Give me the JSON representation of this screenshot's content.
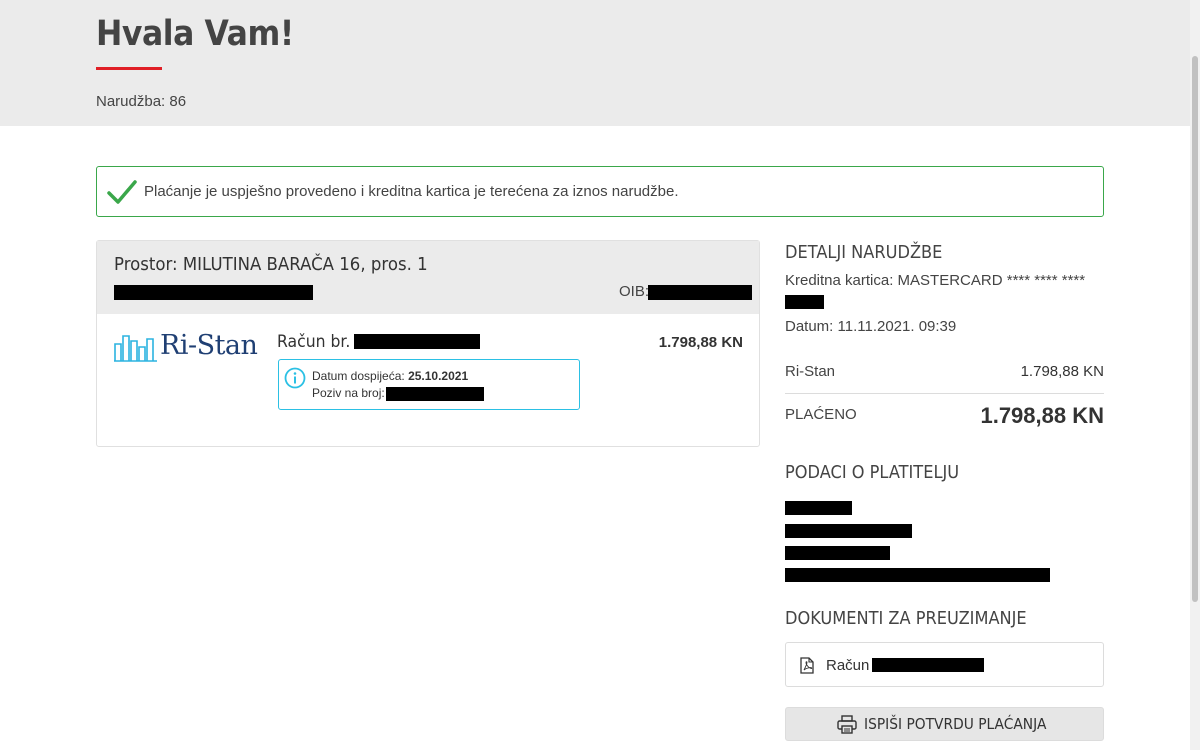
{
  "header": {
    "title": "Hvala Vam!",
    "order_line": "Narudžba: 86"
  },
  "alert": {
    "message": "Plaćanje je uspješno provedeno i kreditna kartica je terećena za iznos narudžbe.",
    "color": "#3aa74a"
  },
  "invoice_card": {
    "location": "Prostor: MILUTINA BARAČA 16, pros. 1",
    "oib_label": "OIB:",
    "logo_text": "Ri-Stan",
    "invoice_label": "Račun br.",
    "amount": "1.798,88 KN",
    "due_label": "Datum dospijeća:",
    "due_date": "25.10.2021",
    "reference_label": "Poziv na broj:"
  },
  "order_details": {
    "title": "DETALJI NARUDŽBE",
    "card_line": "Kreditna kartica: MASTERCARD **** **** ****",
    "date_line": "Datum: 11.11.2021. 09:39",
    "item_name": "Ri-Stan",
    "item_amount": "1.798,88 KN",
    "paid_label": "PLAĆENO",
    "paid_amount": "1.798,88 KN"
  },
  "payer": {
    "title": "PODACI O PLATITELJU"
  },
  "documents": {
    "title": "DOKUMENTI ZA PREUZIMANJE",
    "doc_label": "Račun"
  },
  "actions": {
    "print_label": "ISPIŠI POTVRDU PLAĆANJA"
  },
  "colors": {
    "accent_red": "#e01f26",
    "info_blue": "#2bc0e4",
    "logo_navy": "#1f3f73"
  }
}
